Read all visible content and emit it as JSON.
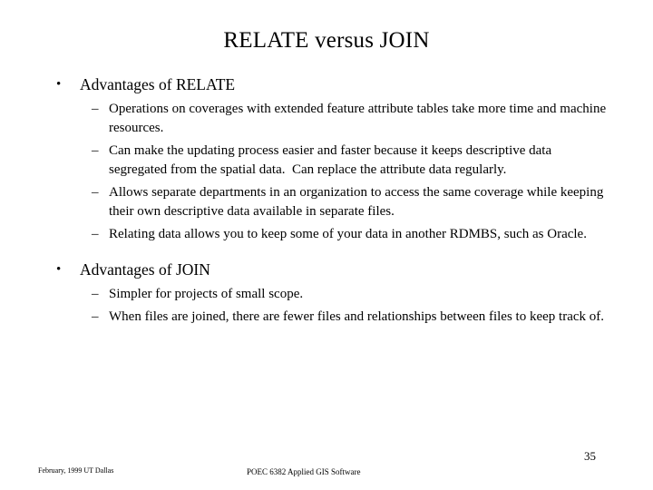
{
  "slide": {
    "title": "RELATE versus JOIN",
    "page_number": "35",
    "bullet_marker": "•",
    "dash_marker": "–",
    "sections": [
      {
        "heading": "Advantages of RELATE",
        "items": [
          "Operations on coverages with extended feature attribute tables take more time and machine resources.",
          "Can make the updating process easier and faster because it keeps descriptive data segregated from the spatial data.  Can replace the attribute data regularly.",
          "Allows separate departments in an organization to access the same coverage while keeping their own descriptive data available in separate files.",
          "Relating data allows you to keep some of your data in another RDMBS, such as Oracle."
        ]
      },
      {
        "heading": "Advantages of JOIN",
        "items": [
          "Simpler for projects of small scope.",
          "When files are joined, there are fewer files and relationships between files to keep track of."
        ]
      }
    ],
    "footer": {
      "left": "February, 1999 UT Dallas",
      "center": "POEC 6382 Applied GIS Software"
    }
  }
}
